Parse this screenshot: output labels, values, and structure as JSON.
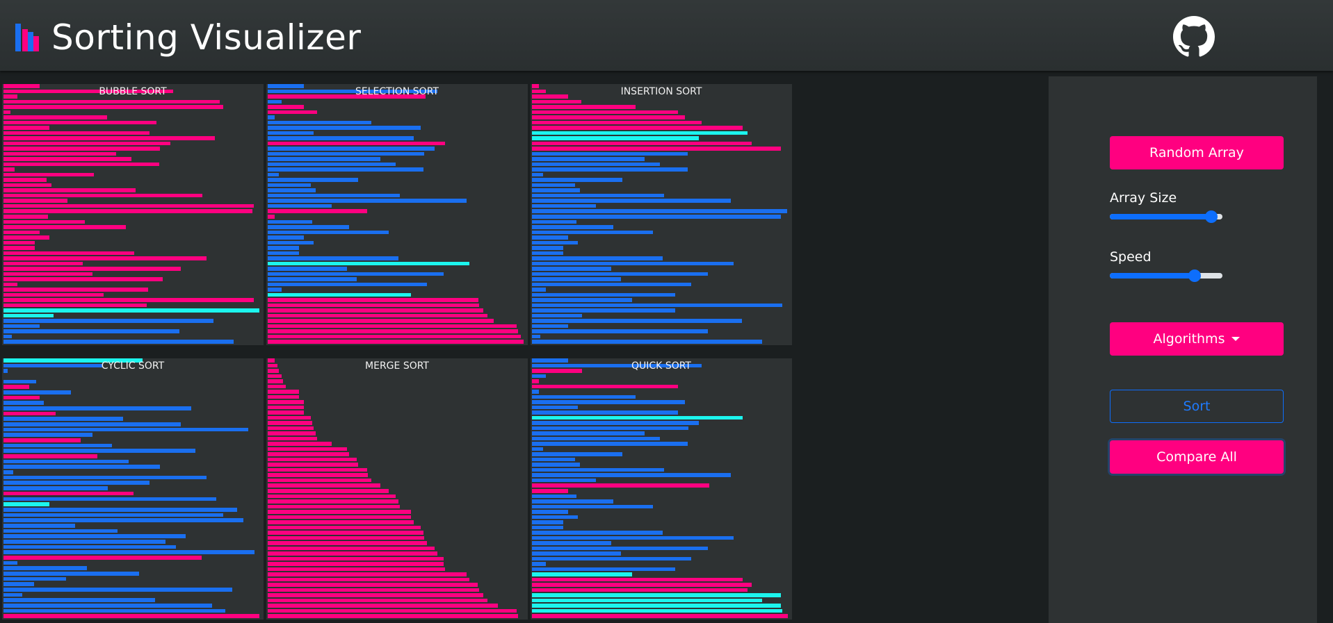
{
  "app": {
    "title": "Sorting Visualizer",
    "logo_icon": "bar-chart-icon",
    "github_icon": "github-icon"
  },
  "colors": {
    "pink": "#ff0080",
    "blue": "#1a6ff0",
    "cyan": "#1cf5ee",
    "panel": "#2e3233",
    "background": "#1b1f20"
  },
  "panels": [
    {
      "title": "BUBBLE SORT",
      "bars": [
        [
          52,
          "p"
        ],
        [
          244,
          "p"
        ],
        [
          20,
          "p"
        ],
        [
          311,
          "p"
        ],
        [
          316,
          "p"
        ],
        [
          10,
          "p"
        ],
        [
          149,
          "p"
        ],
        [
          220,
          "p"
        ],
        [
          66,
          "p"
        ],
        [
          210,
          "p"
        ],
        [
          304,
          "p"
        ],
        [
          240,
          "p"
        ],
        [
          225,
          "p"
        ],
        [
          162,
          "p"
        ],
        [
          184,
          "p"
        ],
        [
          224,
          "p"
        ],
        [
          16,
          "p"
        ],
        [
          130,
          "p"
        ],
        [
          62,
          "p"
        ],
        [
          69,
          "p"
        ],
        [
          190,
          "p"
        ],
        [
          286,
          "p"
        ],
        [
          92,
          "p"
        ],
        [
          360,
          "p"
        ],
        [
          358,
          "p"
        ],
        [
          64,
          "p"
        ],
        [
          117,
          "p"
        ],
        [
          176,
          "p"
        ],
        [
          52,
          "p"
        ],
        [
          66,
          "p"
        ],
        [
          45,
          "p"
        ],
        [
          45,
          "p"
        ],
        [
          188,
          "p"
        ],
        [
          292,
          "p"
        ],
        [
          114,
          "p"
        ],
        [
          255,
          "p"
        ],
        [
          128,
          "p"
        ],
        [
          229,
          "p"
        ],
        [
          20,
          "p"
        ],
        [
          208,
          "p"
        ],
        [
          144,
          "p"
        ],
        [
          360,
          "p"
        ],
        [
          206,
          "p"
        ],
        [
          368,
          "c"
        ],
        [
          72,
          "c"
        ],
        [
          302,
          "b"
        ],
        [
          52,
          "b"
        ],
        [
          253,
          "b"
        ],
        [
          12,
          "b"
        ],
        [
          331,
          "b"
        ]
      ]
    },
    {
      "title": "SELECTION SORT",
      "bars": [
        [
          52,
          "b"
        ],
        [
          244,
          "b"
        ],
        [
          227,
          "p"
        ],
        [
          20,
          "b"
        ],
        [
          52,
          "p"
        ],
        [
          71,
          "p"
        ],
        [
          10,
          "b"
        ],
        [
          149,
          "b"
        ],
        [
          220,
          "b"
        ],
        [
          66,
          "b"
        ],
        [
          210,
          "b"
        ],
        [
          255,
          "p"
        ],
        [
          240,
          "b"
        ],
        [
          225,
          "b"
        ],
        [
          162,
          "b"
        ],
        [
          184,
          "b"
        ],
        [
          224,
          "b"
        ],
        [
          16,
          "b"
        ],
        [
          130,
          "b"
        ],
        [
          62,
          "b"
        ],
        [
          69,
          "b"
        ],
        [
          190,
          "b"
        ],
        [
          286,
          "b"
        ],
        [
          92,
          "b"
        ],
        [
          143,
          "p"
        ],
        [
          10,
          "p"
        ],
        [
          64,
          "b"
        ],
        [
          117,
          "b"
        ],
        [
          174,
          "b"
        ],
        [
          52,
          "b"
        ],
        [
          66,
          "b"
        ],
        [
          45,
          "b"
        ],
        [
          45,
          "b"
        ],
        [
          188,
          "b"
        ],
        [
          290,
          "c"
        ],
        [
          114,
          "b"
        ],
        [
          253,
          "b"
        ],
        [
          128,
          "b"
        ],
        [
          229,
          "b"
        ],
        [
          20,
          "b"
        ],
        [
          206,
          "c"
        ],
        [
          303,
          "p"
        ],
        [
          304,
          "p"
        ],
        [
          310,
          "p"
        ],
        [
          316,
          "p"
        ],
        [
          325,
          "p"
        ],
        [
          358,
          "p"
        ],
        [
          360,
          "p"
        ],
        [
          364,
          "p"
        ],
        [
          368,
          "p"
        ]
      ]
    },
    {
      "title": "INSERTION SORT",
      "bars": [
        [
          10,
          "p"
        ],
        [
          20,
          "p"
        ],
        [
          52,
          "p"
        ],
        [
          71,
          "p"
        ],
        [
          149,
          "p"
        ],
        [
          210,
          "p"
        ],
        [
          220,
          "p"
        ],
        [
          244,
          "p"
        ],
        [
          303,
          "p"
        ],
        [
          310,
          "c"
        ],
        [
          240,
          "c"
        ],
        [
          316,
          "p"
        ],
        [
          358,
          "p"
        ],
        [
          224,
          "b"
        ],
        [
          162,
          "b"
        ],
        [
          184,
          "b"
        ],
        [
          224,
          "b"
        ],
        [
          16,
          "b"
        ],
        [
          130,
          "b"
        ],
        [
          62,
          "b"
        ],
        [
          69,
          "b"
        ],
        [
          190,
          "b"
        ],
        [
          286,
          "b"
        ],
        [
          92,
          "b"
        ],
        [
          367,
          "b"
        ],
        [
          358,
          "b"
        ],
        [
          64,
          "b"
        ],
        [
          117,
          "b"
        ],
        [
          174,
          "b"
        ],
        [
          52,
          "b"
        ],
        [
          66,
          "b"
        ],
        [
          45,
          "b"
        ],
        [
          45,
          "b"
        ],
        [
          188,
          "b"
        ],
        [
          290,
          "b"
        ],
        [
          114,
          "b"
        ],
        [
          253,
          "b"
        ],
        [
          128,
          "b"
        ],
        [
          229,
          "b"
        ],
        [
          20,
          "b"
        ],
        [
          206,
          "b"
        ],
        [
          144,
          "b"
        ],
        [
          360,
          "b"
        ],
        [
          206,
          "b"
        ],
        [
          72,
          "b"
        ],
        [
          302,
          "b"
        ],
        [
          52,
          "b"
        ],
        [
          253,
          "b"
        ],
        [
          12,
          "b"
        ],
        [
          331,
          "b"
        ]
      ]
    },
    {
      "title": "CYCLIC SORT",
      "bars": [
        [
          200,
          "c"
        ],
        [
          142,
          "b"
        ],
        [
          6,
          "b"
        ],
        [
          0,
          "b"
        ],
        [
          47,
          "b"
        ],
        [
          37,
          "p"
        ],
        [
          97,
          "b"
        ],
        [
          52,
          "p"
        ],
        [
          58,
          "b"
        ],
        [
          270,
          "b"
        ],
        [
          75,
          "p"
        ],
        [
          172,
          "b"
        ],
        [
          255,
          "b"
        ],
        [
          352,
          "b"
        ],
        [
          128,
          "b"
        ],
        [
          111,
          "p"
        ],
        [
          156,
          "b"
        ],
        [
          276,
          "b"
        ],
        [
          135,
          "p"
        ],
        [
          180,
          "b"
        ],
        [
          225,
          "b"
        ],
        [
          14,
          "b"
        ],
        [
          292,
          "b"
        ],
        [
          210,
          "b"
        ],
        [
          150,
          "b"
        ],
        [
          187,
          "p"
        ],
        [
          306,
          "b"
        ],
        [
          66,
          "c"
        ],
        [
          336,
          "b"
        ],
        [
          316,
          "b"
        ],
        [
          345,
          "b"
        ],
        [
          103,
          "b"
        ],
        [
          164,
          "b"
        ],
        [
          262,
          "b"
        ],
        [
          233,
          "b"
        ],
        [
          248,
          "b"
        ],
        [
          361,
          "b"
        ],
        [
          285,
          "p"
        ],
        [
          20,
          "b"
        ],
        [
          120,
          "b"
        ],
        [
          195,
          "b"
        ],
        [
          90,
          "b"
        ],
        [
          44,
          "b"
        ],
        [
          329,
          "b"
        ],
        [
          27,
          "b"
        ],
        [
          218,
          "b"
        ],
        [
          300,
          "b"
        ],
        [
          319,
          "b"
        ],
        [
          368,
          "p"
        ]
      ]
    },
    {
      "title": "MERGE SORT",
      "bars": [
        [
          10,
          "p"
        ],
        [
          14,
          "p"
        ],
        [
          16,
          "p"
        ],
        [
          20,
          "p"
        ],
        [
          22,
          "p"
        ],
        [
          26,
          "p"
        ],
        [
          45,
          "p"
        ],
        [
          45,
          "p"
        ],
        [
          52,
          "p"
        ],
        [
          52,
          "p"
        ],
        [
          52,
          "p"
        ],
        [
          62,
          "p"
        ],
        [
          64,
          "p"
        ],
        [
          66,
          "p"
        ],
        [
          69,
          "p"
        ],
        [
          71,
          "p"
        ],
        [
          92,
          "p"
        ],
        [
          114,
          "p"
        ],
        [
          117,
          "p"
        ],
        [
          128,
          "p"
        ],
        [
          130,
          "p"
        ],
        [
          143,
          "p"
        ],
        [
          144,
          "p"
        ],
        [
          149,
          "p"
        ],
        [
          162,
          "p"
        ],
        [
          174,
          "p"
        ],
        [
          184,
          "p"
        ],
        [
          188,
          "p"
        ],
        [
          190,
          "p"
        ],
        [
          206,
          "p"
        ],
        [
          206,
          "p"
        ],
        [
          210,
          "p"
        ],
        [
          220,
          "p"
        ],
        [
          224,
          "p"
        ],
        [
          225,
          "p"
        ],
        [
          229,
          "p"
        ],
        [
          240,
          "p"
        ],
        [
          244,
          "p"
        ],
        [
          253,
          "p"
        ],
        [
          253,
          "p"
        ],
        [
          255,
          "p"
        ],
        [
          286,
          "p"
        ],
        [
          290,
          "p"
        ],
        [
          302,
          "p"
        ],
        [
          304,
          "p"
        ],
        [
          310,
          "p"
        ],
        [
          316,
          "p"
        ],
        [
          331,
          "p"
        ],
        [
          358,
          "p"
        ],
        [
          360,
          "p"
        ]
      ]
    },
    {
      "title": "QUICK SORT",
      "bars": [
        [
          52,
          "b"
        ],
        [
          244,
          "b"
        ],
        [
          72,
          "p"
        ],
        [
          20,
          "b"
        ],
        [
          10,
          "p"
        ],
        [
          210,
          "p"
        ],
        [
          10,
          "b"
        ],
        [
          149,
          "b"
        ],
        [
          220,
          "b"
        ],
        [
          66,
          "b"
        ],
        [
          210,
          "b"
        ],
        [
          303,
          "c"
        ],
        [
          240,
          "b"
        ],
        [
          225,
          "b"
        ],
        [
          162,
          "b"
        ],
        [
          184,
          "b"
        ],
        [
          224,
          "b"
        ],
        [
          16,
          "b"
        ],
        [
          130,
          "b"
        ],
        [
          62,
          "b"
        ],
        [
          69,
          "b"
        ],
        [
          190,
          "b"
        ],
        [
          286,
          "b"
        ],
        [
          92,
          "b"
        ],
        [
          255,
          "p"
        ],
        [
          52,
          "p"
        ],
        [
          64,
          "b"
        ],
        [
          117,
          "b"
        ],
        [
          174,
          "b"
        ],
        [
          52,
          "b"
        ],
        [
          66,
          "b"
        ],
        [
          45,
          "b"
        ],
        [
          45,
          "b"
        ],
        [
          188,
          "b"
        ],
        [
          290,
          "b"
        ],
        [
          114,
          "b"
        ],
        [
          253,
          "b"
        ],
        [
          128,
          "b"
        ],
        [
          229,
          "b"
        ],
        [
          20,
          "b"
        ],
        [
          206,
          "b"
        ],
        [
          144,
          "c"
        ],
        [
          303,
          "p"
        ],
        [
          316,
          "p"
        ],
        [
          310,
          "p"
        ],
        [
          358,
          "c"
        ],
        [
          331,
          "c"
        ],
        [
          358,
          "c"
        ],
        [
          360,
          "c"
        ],
        [
          368,
          "p"
        ]
      ]
    }
  ],
  "controls": {
    "random_array": "Random Array",
    "array_size_label": "Array Size",
    "array_size_value": 0.9,
    "speed_label": "Speed",
    "speed_value": 0.75,
    "algorithms": "Algorithms",
    "sort": "Sort",
    "compare_all": "Compare All"
  }
}
